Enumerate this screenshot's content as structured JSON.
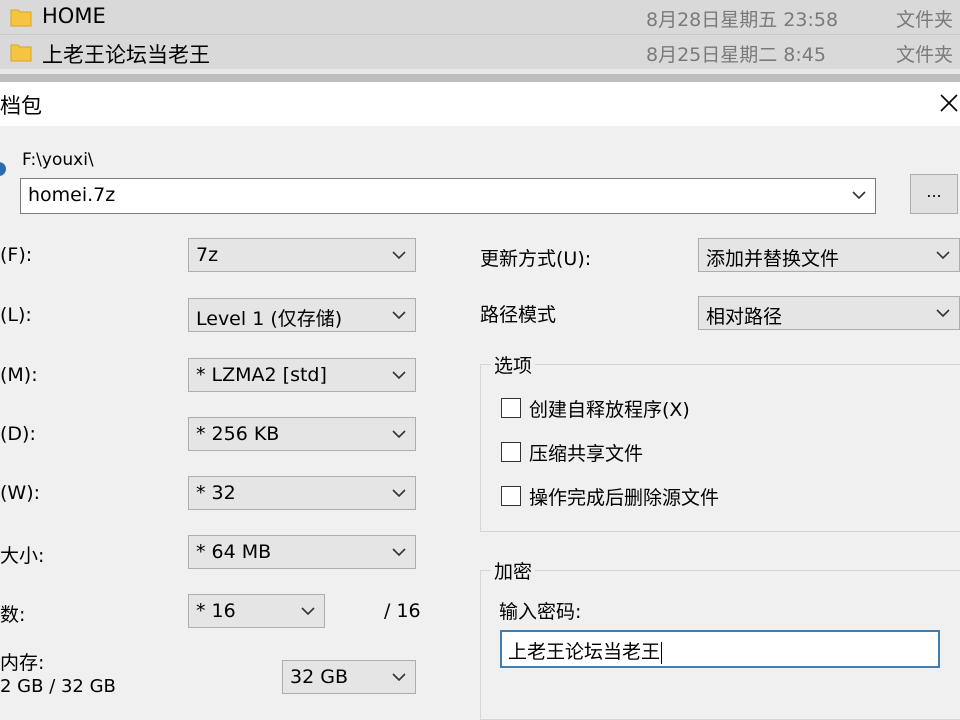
{
  "explorer": {
    "rows": [
      {
        "name": "HOME",
        "date": "8月28日星期五 23:58",
        "type": "文件夹"
      },
      {
        "name": "上老王论坛当老王",
        "date": "8月25日星期二 8:45",
        "type": "文件夹"
      }
    ]
  },
  "dialog": {
    "title": "档包",
    "path_label": "F:\\youxi\\",
    "archive_name": "homei.7z",
    "browse_label": "...",
    "fields": {
      "format": {
        "label": "(F):",
        "value": "7z"
      },
      "level": {
        "label": "(L):",
        "value": "Level 1 (仅存储)"
      },
      "method": {
        "label": "(M):",
        "value": "* LZMA2 [std]"
      },
      "dict": {
        "label": "(D):",
        "value": "* 256 KB"
      },
      "word": {
        "label": "(W):",
        "value": "* 32"
      },
      "solid": {
        "label": "大小:",
        "value": "* 64 MB"
      },
      "threads": {
        "label": "数:",
        "value": "* 16",
        "max": "/ 16"
      },
      "memory": {
        "label": "内存:",
        "usage": "2 GB / 32 GB",
        "value": "32 GB"
      }
    },
    "update": {
      "label": "更新方式(U):",
      "value": "添加并替换文件"
    },
    "pathmode": {
      "label": "路径模式",
      "value": "相对路径"
    },
    "options": {
      "title": "选项",
      "items": [
        {
          "label": "创建自释放程序(X)",
          "checked": false
        },
        {
          "label": "压缩共享文件",
          "checked": false
        },
        {
          "label": "操作完成后删除源文件",
          "checked": false
        }
      ]
    },
    "encryption": {
      "title": "加密",
      "password_label": "输入密码:",
      "password_value": "上老王论坛当老王"
    }
  },
  "icons": {
    "folder": "folder-icon",
    "close": "close-icon",
    "chevron": "chevron-down-icon"
  },
  "colors": {
    "folder": "#f5c542",
    "focus_border": "#3c7fb1",
    "titlebar": "#ffffff"
  }
}
